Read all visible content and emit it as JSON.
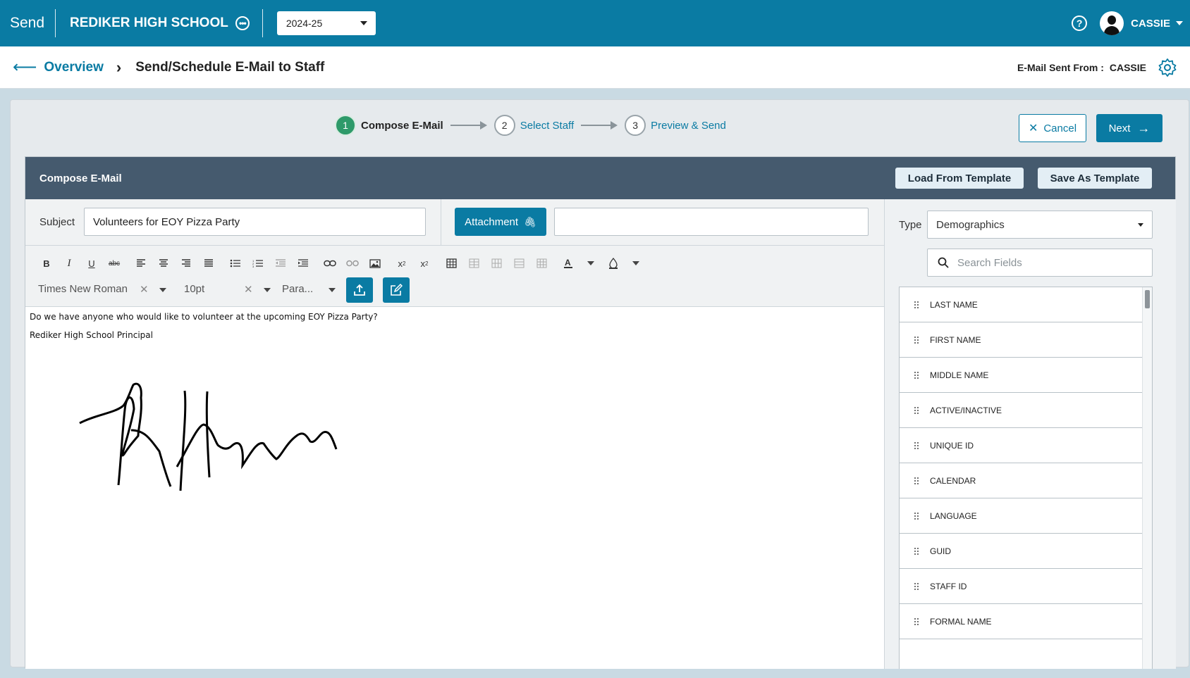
{
  "header": {
    "app_name": "Send",
    "school": "REDIKER HIGH SCHOOL",
    "year": "2024-25",
    "user": "CASSIE",
    "help_icon": "help-circle-icon"
  },
  "breadcrumb": {
    "back": "Overview",
    "title": "Send/Schedule E-Mail to Staff",
    "sent_from_label": "E-Mail Sent From :",
    "sent_from_value": "CASSIE"
  },
  "stepper": {
    "steps": [
      {
        "num": "1",
        "label": "Compose E-Mail"
      },
      {
        "num": "2",
        "label": "Select Staff"
      },
      {
        "num": "3",
        "label": "Preview & Send"
      }
    ]
  },
  "actions": {
    "cancel": "Cancel",
    "next": "Next"
  },
  "compose": {
    "title": "Compose E-Mail",
    "load_template": "Load From Template",
    "save_template": "Save As Template",
    "subject_label": "Subject",
    "subject_value": "Volunteers for EOY Pizza Party",
    "attachment_label": "Attachment",
    "attachment_value": ""
  },
  "toolbar": {
    "font": "Times New Roman",
    "size": "10pt",
    "format": "Para..."
  },
  "editor": {
    "line1": "Do we have anyone who would like to volunteer at the upcoming EOY Pizza Party?",
    "line2": "Rediker High School Principal"
  },
  "fields_panel": {
    "type_label": "Type",
    "type_value": "Demographics",
    "search_placeholder": "Search Fields",
    "items": [
      "LAST NAME",
      "FIRST NAME",
      "MIDDLE NAME",
      "ACTIVE/INACTIVE",
      "UNIQUE ID",
      "CALENDAR",
      "LANGUAGE",
      "GUID",
      "STAFF ID",
      "FORMAL NAME"
    ]
  },
  "colors": {
    "primary": "#0a7ba3",
    "header_dark": "#455a6e",
    "step_active": "#2e9a6a"
  }
}
